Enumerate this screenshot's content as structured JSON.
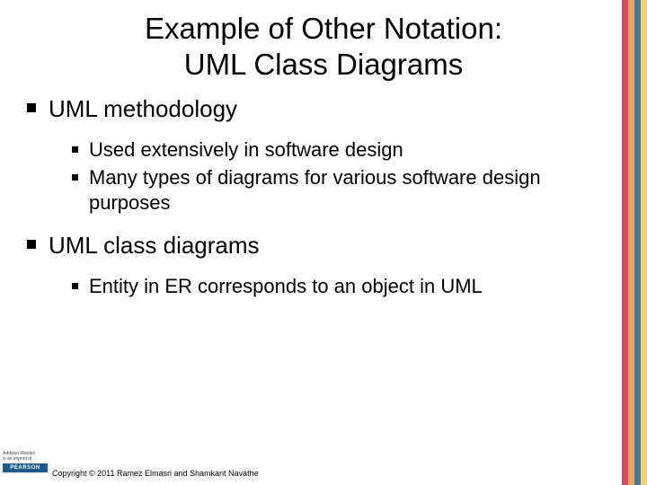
{
  "title_line1": "Example of Other Notation:",
  "title_line2": "UML Class Diagrams",
  "bullets": [
    {
      "label": "UML methodology",
      "children": [
        {
          "label": "Used extensively in software design"
        },
        {
          "label": "Many types of diagrams for various software design purposes"
        }
      ]
    },
    {
      "label": "UML class diagrams",
      "children": [
        {
          "label": "Entity in ER corresponds to an object in UML"
        }
      ]
    }
  ],
  "publisher": {
    "imprint_line1": "Addison-Wesley",
    "imprint_line2": "is an imprint of",
    "brand": "PEARSON"
  },
  "copyright": "Copyright © 2011 Ramez Elmasri and Shamkant Navathe"
}
